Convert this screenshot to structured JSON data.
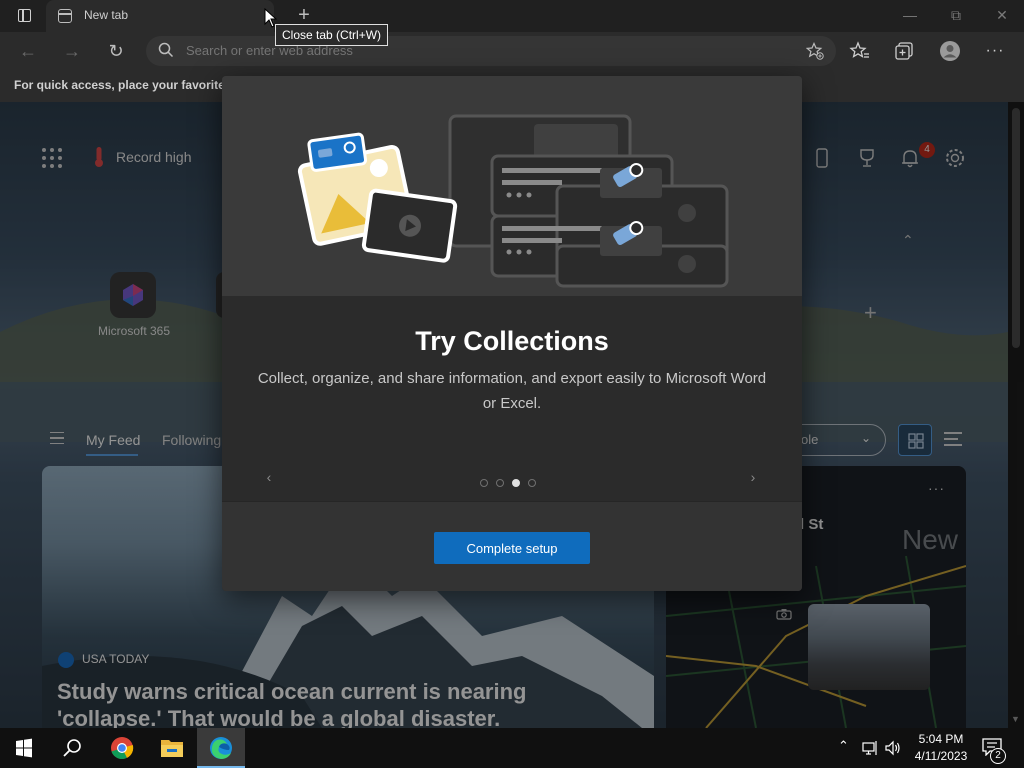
{
  "browser": {
    "tab_title": "New tab",
    "tooltip": "Close tab (Ctrl+W)",
    "address_placeholder": "Search or enter web address",
    "favorites_hint": "For quick access, place your favorites h"
  },
  "newtab": {
    "weather": "Record high",
    "notification_count": "4",
    "quick_link_label": "Microsoft 365",
    "feed_tabs": [
      "My Feed",
      "Following"
    ],
    "layout_select_value": "ole"
  },
  "feed": {
    "main_card": {
      "source": "USA TODAY",
      "headline": "Study warns critical ocean current is nearing 'collapse.' That would be a global disaster."
    },
    "map_card": {
      "title_fragment": "l St",
      "overlay_text": "New",
      "more": "···"
    }
  },
  "modal": {
    "title": "Try Collections",
    "description": "Collect, organize, and share information, and export easily to Microsoft Word or Excel.",
    "button": "Complete setup",
    "steps_total": 4,
    "steps_active": 3
  },
  "taskbar": {
    "time": "5:04 PM",
    "date": "4/11/2023",
    "notifications": "2",
    "apps": [
      "start-button",
      "search-button",
      "chrome",
      "file-explorer",
      "edge"
    ]
  },
  "colors": {
    "accent": "#0f6cbd",
    "badge_red": "#c42b1c",
    "edge_underline": "#76b9ed"
  }
}
